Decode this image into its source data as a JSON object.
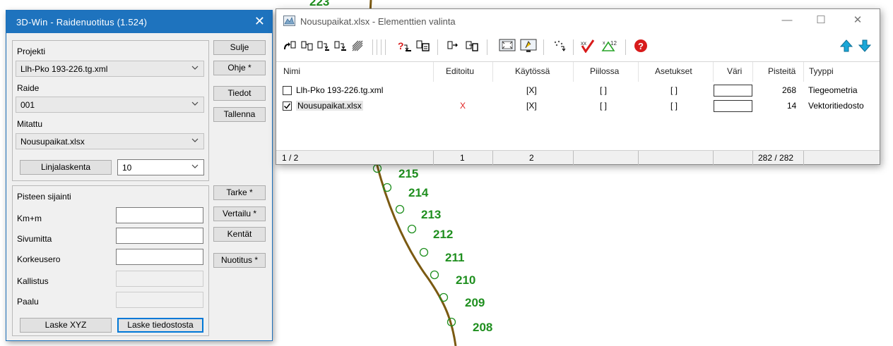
{
  "map": {
    "stations": [
      "223",
      "215",
      "214",
      "213",
      "212",
      "211",
      "210",
      "209",
      "208"
    ],
    "colors": {
      "alignment": "#7b5a12",
      "labels": "#1f8f1f"
    }
  },
  "dialog": {
    "title": "3D-Win - Raidenuotitus  (1.524)",
    "close_glyph": "✕",
    "projekti_label": "Projekti",
    "projekti_value": "Llh-Pko 193-226.tg.xml",
    "raide_label": "Raide",
    "raide_value": "001",
    "mitattu_label": "Mitattu",
    "mitattu_value": "Nousupaikat.xlsx",
    "linjalaskenta_label": "Linjalaskenta",
    "linjalaskenta_value": "10",
    "pisteen_sijainti_label": "Pisteen sijainti",
    "fields": {
      "km": "Km+m",
      "sivumitta": "Sivumitta",
      "korkeusero": "Korkeusero",
      "kallistus": "Kallistus",
      "paalu": "Paalu"
    },
    "buttons": {
      "sulje": "Sulje",
      "ohje": "Ohje *",
      "tiedot": "Tiedot",
      "tallenna": "Tallenna",
      "tarke": "Tarke *",
      "vertailu": "Vertailu *",
      "kentat": "Kentät",
      "nuotitus": "Nuotitus *",
      "laske_xyz": "Laske XYZ",
      "laske_tiedostosta": "Laske tiedostosta"
    }
  },
  "window": {
    "title": "Nousupaikat.xlsx - Elementtien valinta",
    "controls": {
      "minimize": "—",
      "maximize": "☐",
      "close": "✕"
    },
    "columns": [
      "Nimi",
      "Editoitu",
      "Käytössä",
      "Piilossa",
      "Asetukset",
      "Väri",
      "Pisteitä",
      "Tyyppi"
    ],
    "rows": [
      {
        "checked": false,
        "name": "Llh-Pko 193-226.tg.xml",
        "editoitu": "",
        "kaytossa": "[X]",
        "piilossa": "[ ]",
        "asetukset": "[ ]",
        "pisteita": "268",
        "tyyppi": "Tiegeometria"
      },
      {
        "checked": true,
        "name": "Nousupaikat.xlsx",
        "editoitu": "X",
        "kaytossa": "[X]",
        "piilossa": "[ ]",
        "asetukset": "[ ]",
        "pisteita": "14",
        "tyyppi": "Vektoritiedosto"
      }
    ],
    "status": {
      "position": "1 / 2",
      "editoitu": "1",
      "kaytossa": "2",
      "pisteita": "282 / 282"
    },
    "colors": {
      "editoitu_mark": "#e02020",
      "accent_arrows": "#19a7d8",
      "help": "#d81b1b"
    },
    "toolbar_icons": [
      "new-element-icon",
      "copy-element-icon",
      "move-up-icon",
      "move-down-icon",
      "hatch-icon",
      "find-element-icon",
      "element-properties-icon",
      "export-icon",
      "import-icon",
      "zoom-extent-icon",
      "display-icon",
      "points-icon",
      "check-icon",
      "statistics-icon",
      "help-icon",
      "arrow-up-icon",
      "arrow-down-icon"
    ]
  }
}
